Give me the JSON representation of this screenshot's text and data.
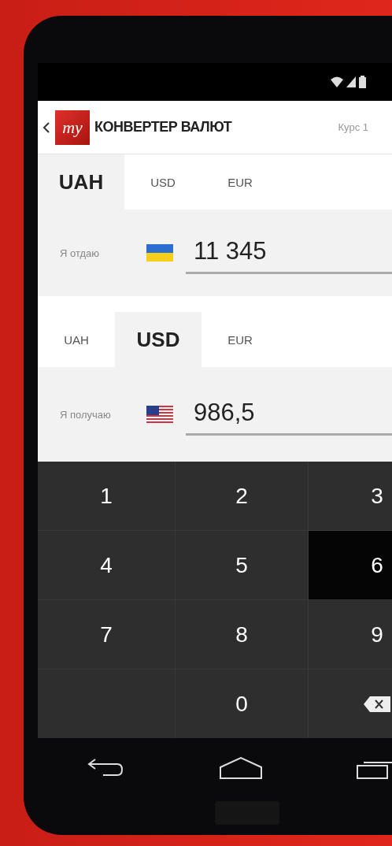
{
  "app_bar": {
    "logo_text": "my",
    "title": "КОНВЕРТЕР ВАЛЮТ",
    "rate": "Курс 1"
  },
  "from": {
    "tabs": [
      {
        "label": "UAH",
        "selected": true
      },
      {
        "label": "USD",
        "selected": false
      },
      {
        "label": "EUR",
        "selected": false
      }
    ],
    "label": "Я отдаю",
    "flag": {
      "kind": "ua"
    },
    "value": "11 345"
  },
  "to": {
    "tabs": [
      {
        "label": "UAH",
        "selected": false
      },
      {
        "label": "USD",
        "selected": true
      },
      {
        "label": "EUR",
        "selected": false
      }
    ],
    "label": "Я получаю",
    "flag": {
      "kind": "us"
    },
    "value": "986,5"
  },
  "keypad": [
    {
      "kind": "digit",
      "label": "1",
      "pressed": false
    },
    {
      "kind": "digit",
      "label": "2",
      "pressed": false
    },
    {
      "kind": "digit",
      "label": "3",
      "pressed": false
    },
    {
      "kind": "digit",
      "label": "4",
      "pressed": false
    },
    {
      "kind": "digit",
      "label": "5",
      "pressed": false
    },
    {
      "kind": "digit",
      "label": "6",
      "pressed": true
    },
    {
      "kind": "digit",
      "label": "7",
      "pressed": false
    },
    {
      "kind": "digit",
      "label": "8",
      "pressed": false
    },
    {
      "kind": "digit",
      "label": "9",
      "pressed": false
    },
    {
      "kind": "blank",
      "pressed": false
    },
    {
      "kind": "digit",
      "label": "0",
      "pressed": false
    },
    {
      "kind": "backspace",
      "pressed": false
    }
  ]
}
